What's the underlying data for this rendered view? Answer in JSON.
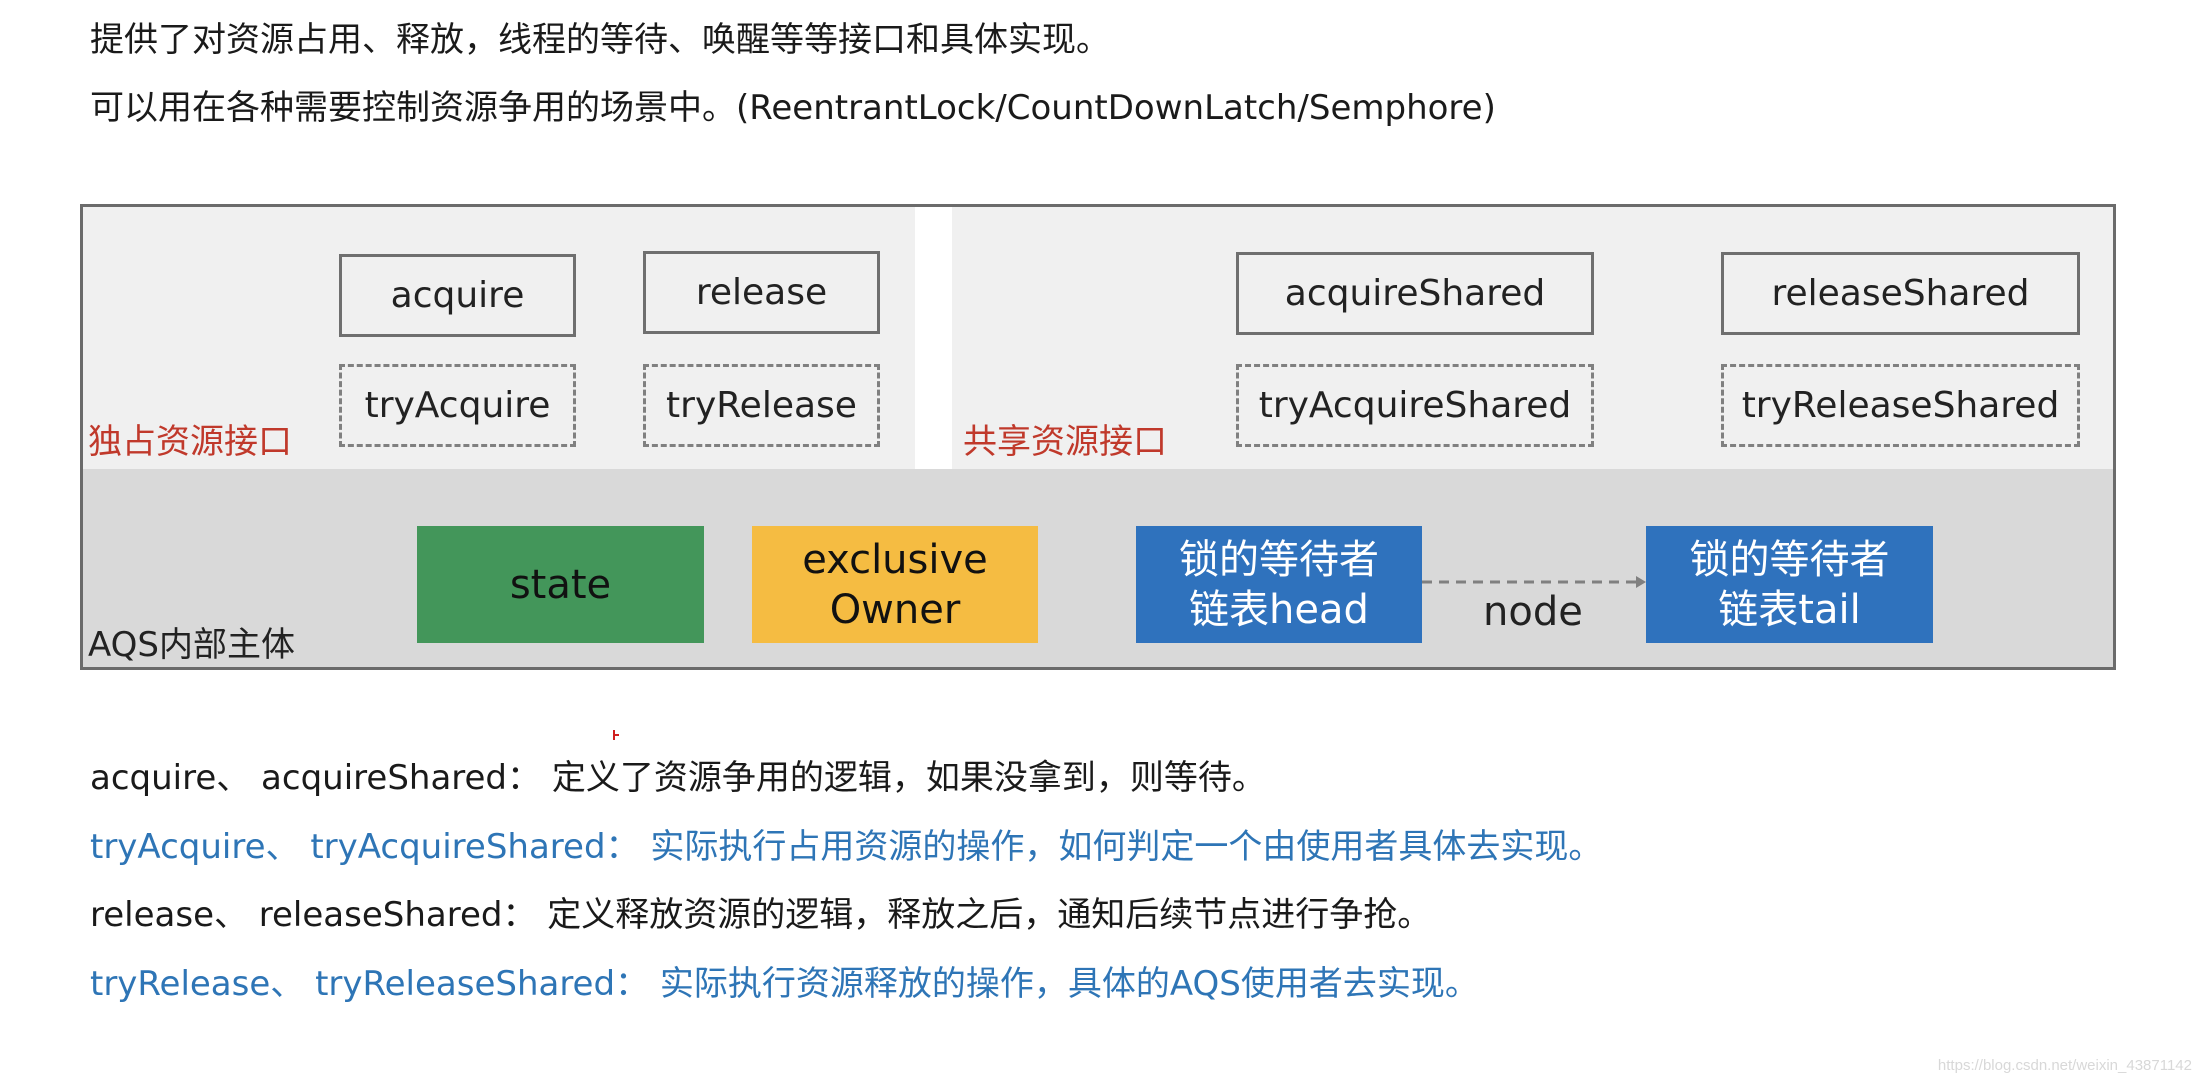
{
  "intro": {
    "line1": "提供了对资源占用、释放，线程的等待、唤醒等等接口和具体实现。",
    "line2": "可以用在各种需要控制资源争用的场景中。(ReentrantLock/CountDownLatch/Semphore)"
  },
  "diagram": {
    "exclusive": {
      "label": "独占资源接口",
      "methods": [
        {
          "name": "acquire",
          "try": "tryAcquire"
        },
        {
          "name": "release",
          "try": "tryRelease"
        }
      ]
    },
    "shared": {
      "label": "共享资源接口",
      "methods": [
        {
          "name": "acquireShared",
          "try": "tryAcquireShared"
        },
        {
          "name": "releaseShared",
          "try": "tryReleaseShared"
        }
      ]
    },
    "core": {
      "label": "AQS内部主体",
      "state": "state",
      "owner_line1": "exclusive",
      "owner_line2": "Owner",
      "head_line1": "锁的等待者",
      "head_line2": "链表head",
      "tail_line1": "锁的等待者",
      "tail_line2": "链表tail",
      "link_label": "node"
    },
    "colors": {
      "state": "#43965a",
      "owner": "#f5bc42",
      "queue": "#2f72bd",
      "label_red": "#c0392b",
      "blue_text": "#2e75b6"
    }
  },
  "notes": [
    {
      "text": "acquire、 acquireShared： 定义了资源争用的逻辑，如果没拿到，则等待。",
      "color": "black"
    },
    {
      "text": "tryAcquire、 tryAcquireShared： 实际执行占用资源的操作，如何判定一个由使用者具体去实现。",
      "color": "blue"
    },
    {
      "text": "release、 releaseShared： 定义释放资源的逻辑，释放之后，通知后续节点进行争抢。",
      "color": "black"
    },
    {
      "text": "tryRelease、 tryReleaseShared： 实际执行资源释放的操作，具体的AQS使用者去实现。",
      "color": "blue"
    }
  ],
  "watermark": "https://blog.csdn.net/weixin_43871142"
}
